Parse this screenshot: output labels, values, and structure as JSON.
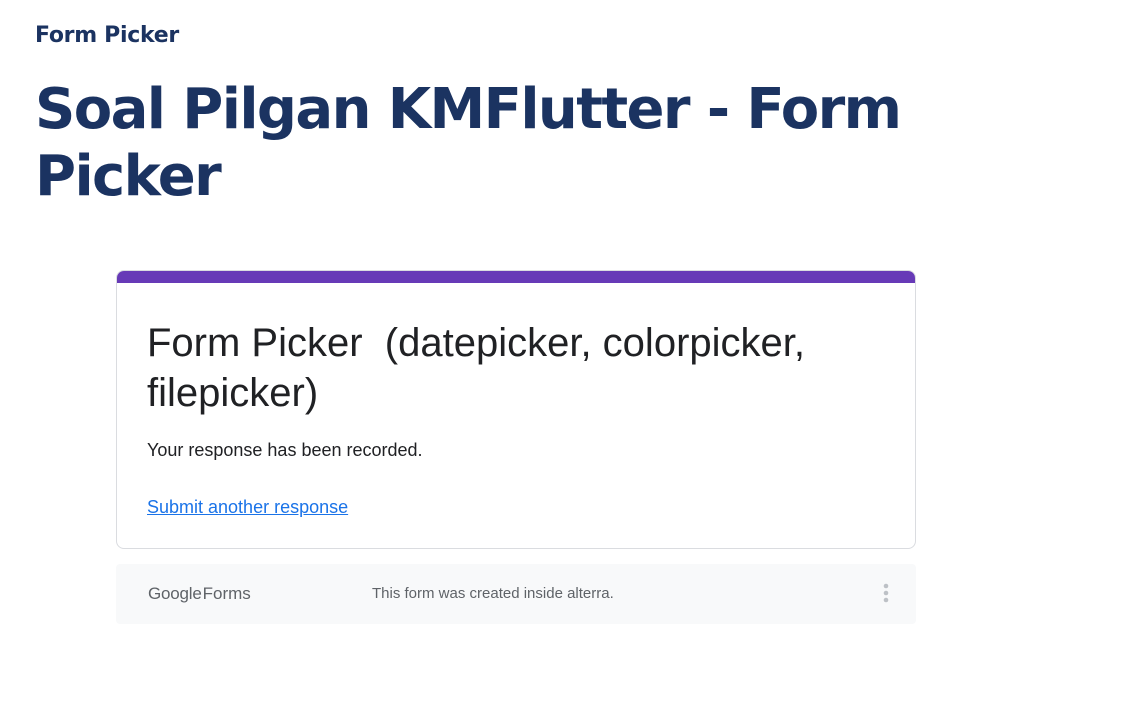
{
  "breadcrumb": "Form Picker",
  "page_title": "Soal Pilgan KMFlutter - Form Picker",
  "form": {
    "accent_color": "#673ab7",
    "title": "Form Picker  (datepicker, colorpicker, filepicker)",
    "confirmation": "Your response has been recorded.",
    "submit_another": "Submit another response"
  },
  "footer": {
    "logo_google": "Google",
    "logo_forms": "Forms",
    "note": "This form was created inside alterra.",
    "menu_icon": "more-vert-icon"
  }
}
